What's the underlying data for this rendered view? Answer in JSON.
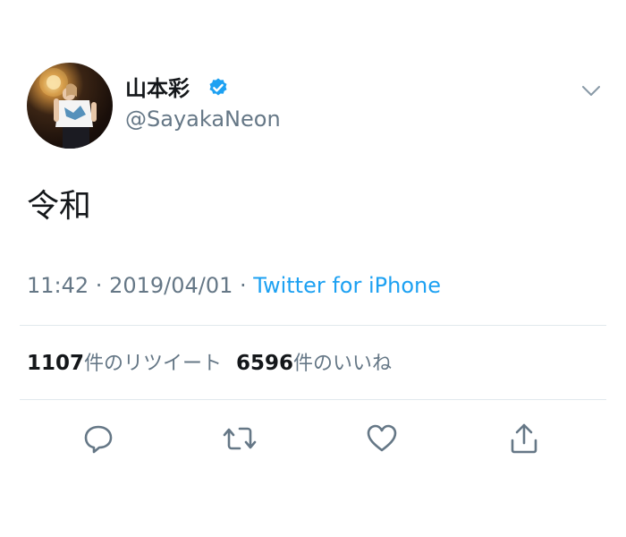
{
  "user": {
    "display_name": "山本彩",
    "handle": "@SayakaNeon",
    "verified": true
  },
  "tweet": {
    "text": "令和"
  },
  "meta": {
    "time": "11:42",
    "sep1": " · ",
    "date": "2019/04/01",
    "sep2": " · ",
    "source": "Twitter for iPhone"
  },
  "stats": {
    "retweets_count": "1107",
    "retweets_label": "件のリツイート",
    "likes_count": "6596",
    "likes_label": "件のいいね"
  },
  "icons": {
    "menu": "chevron-down-icon",
    "verified": "verified-badge-icon",
    "reply": "reply-icon",
    "retweet": "retweet-icon",
    "like": "heart-icon",
    "share": "share-icon"
  },
  "colors": {
    "text": "#14171a",
    "secondary": "#657786",
    "link": "#1da1f2",
    "verified": "#1da1f2",
    "divider": "#e1e8ed"
  }
}
